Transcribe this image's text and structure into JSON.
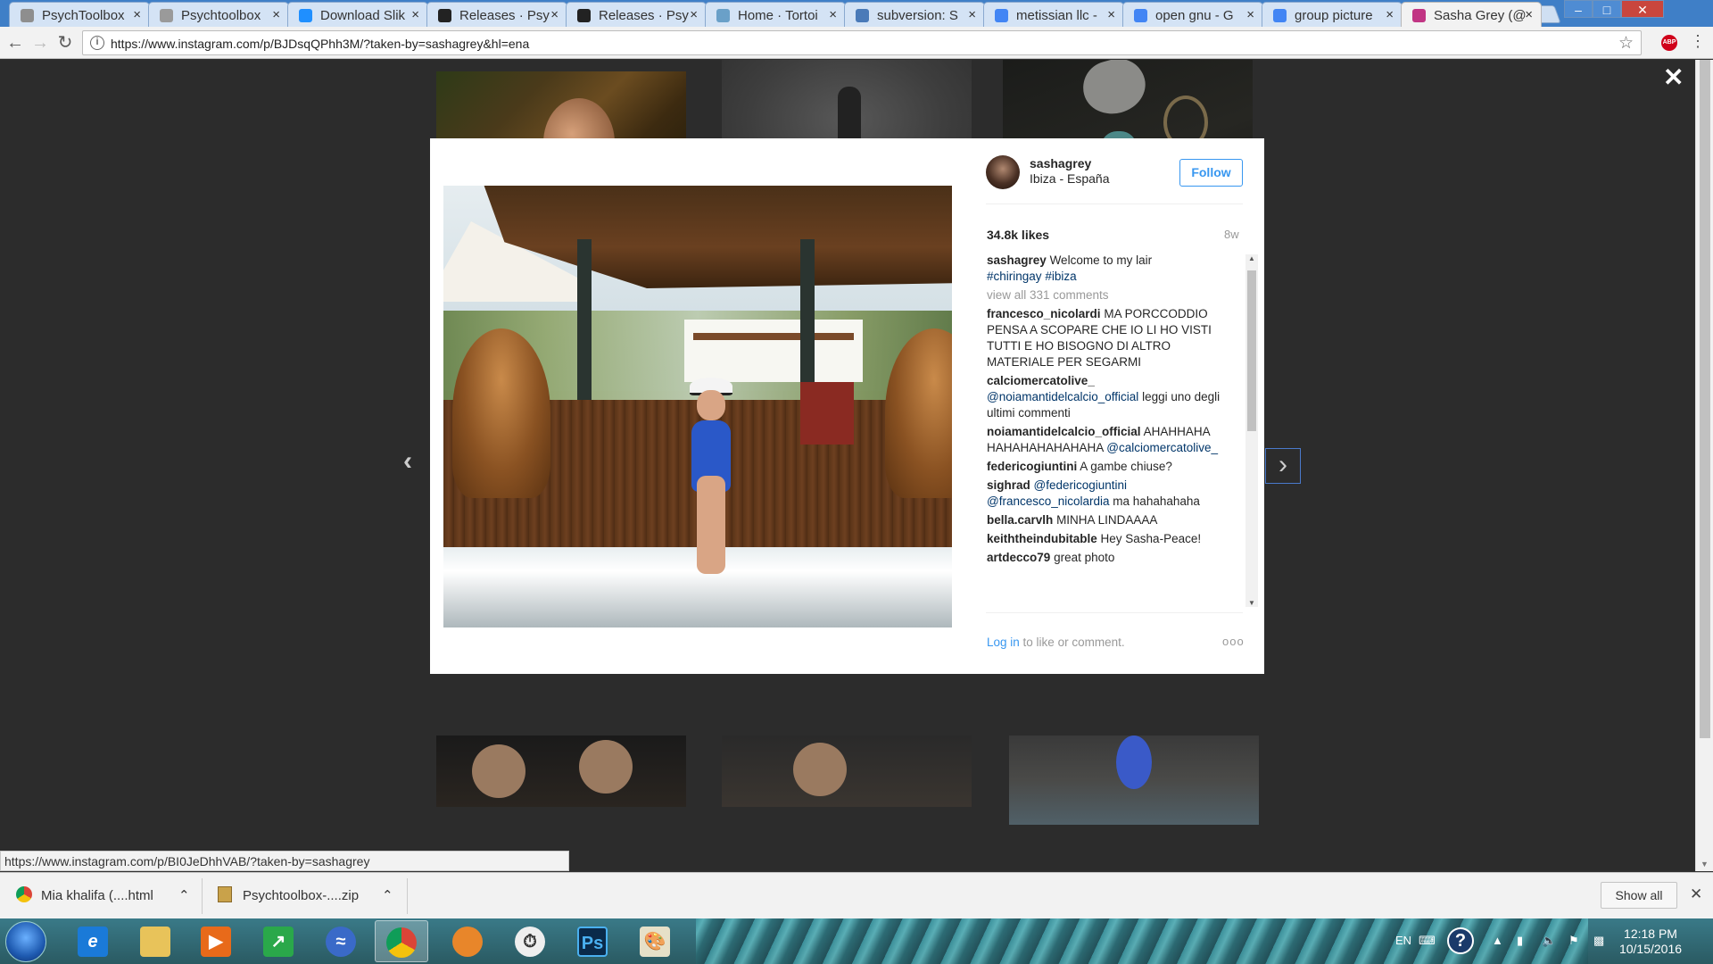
{
  "browser": {
    "tabs": [
      {
        "title": "PsychToolbox",
        "icon_color": "#8e8e8e"
      },
      {
        "title": "Psychtoolbox",
        "icon_color": "#9a9a9a"
      },
      {
        "title": "Download Slik",
        "icon_color": "#1f8fff"
      },
      {
        "title": "Releases · Psy",
        "icon_color": "#222222"
      },
      {
        "title": "Releases · Psy",
        "icon_color": "#222222"
      },
      {
        "title": "Home · Tortoi",
        "icon_color": "#6aa0c8"
      },
      {
        "title": "subversion: S",
        "icon_color": "#4a7ab8"
      },
      {
        "title": "metissian llc -",
        "icon_color": "#4285f4"
      },
      {
        "title": "open gnu - G",
        "icon_color": "#4285f4"
      },
      {
        "title": "group picture",
        "icon_color": "#4285f4"
      },
      {
        "title": "Sasha Grey (@",
        "icon_color": "#c13584"
      }
    ],
    "url": "https://www.instagram.com/p/BJDsqQPhh3M/?taken-by=sashagrey&hl=ena",
    "status_url": "https://www.instagram.com/p/BI0JeDhhVAB/?taken-by=sashagrey"
  },
  "post": {
    "username": "sashagrey",
    "location": "Ibiza - España",
    "follow_label": "Follow",
    "likes": "34.8k likes",
    "time_ago": "8w",
    "caption": {
      "user": "sashagrey",
      "text": "Welcome to my lair",
      "tags": [
        "#chiringay",
        "#ibiza"
      ]
    },
    "view_all": "view all 331 comments",
    "comments": [
      {
        "user": "francesco_nicolardi",
        "text": "MA PORCCODDIO PENSA A SCOPARE CHE IO LI HO VISTI TUTTI E HO BISOGNO DI ALTRO MATERIALE PER SEGARMI"
      },
      {
        "user": "calciomercatolive_",
        "mention": "@noiamantidelcalcio_official",
        "text": "leggi uno degli ultimi commenti"
      },
      {
        "user": "noiamantidelcalcio_official",
        "text": "AHAHHAHA HAHAHAHAHAHAHA",
        "mention": "@calciomercatolive_"
      },
      {
        "user": "federicogiuntini",
        "text": "A gambe chiuse?"
      },
      {
        "user": "sighrad",
        "mention": "@federicogiuntini",
        "mention2": "@francesco_nicolardia",
        "text": "ma hahahahaha"
      },
      {
        "user": "bella.carvlh",
        "text": "MINHA LINDAAAA"
      },
      {
        "user": "keiththeindubitable",
        "text": "Hey Sasha-Peace!"
      },
      {
        "user": "artdecco79",
        "text": "great photo"
      }
    ],
    "login_link": "Log in",
    "login_suffix": " to like or comment.",
    "more_icon": "ooo"
  },
  "downloads": [
    {
      "name": "Mia khalifa (....html",
      "icon": "chrome-icon"
    },
    {
      "name": "Psychtoolbox-....zip",
      "icon": "zip-icon"
    }
  ],
  "shelf": {
    "show_all": "Show all"
  },
  "taskbar": {
    "lang": "EN",
    "time": "12:18 PM",
    "date": "10/15/2016"
  }
}
